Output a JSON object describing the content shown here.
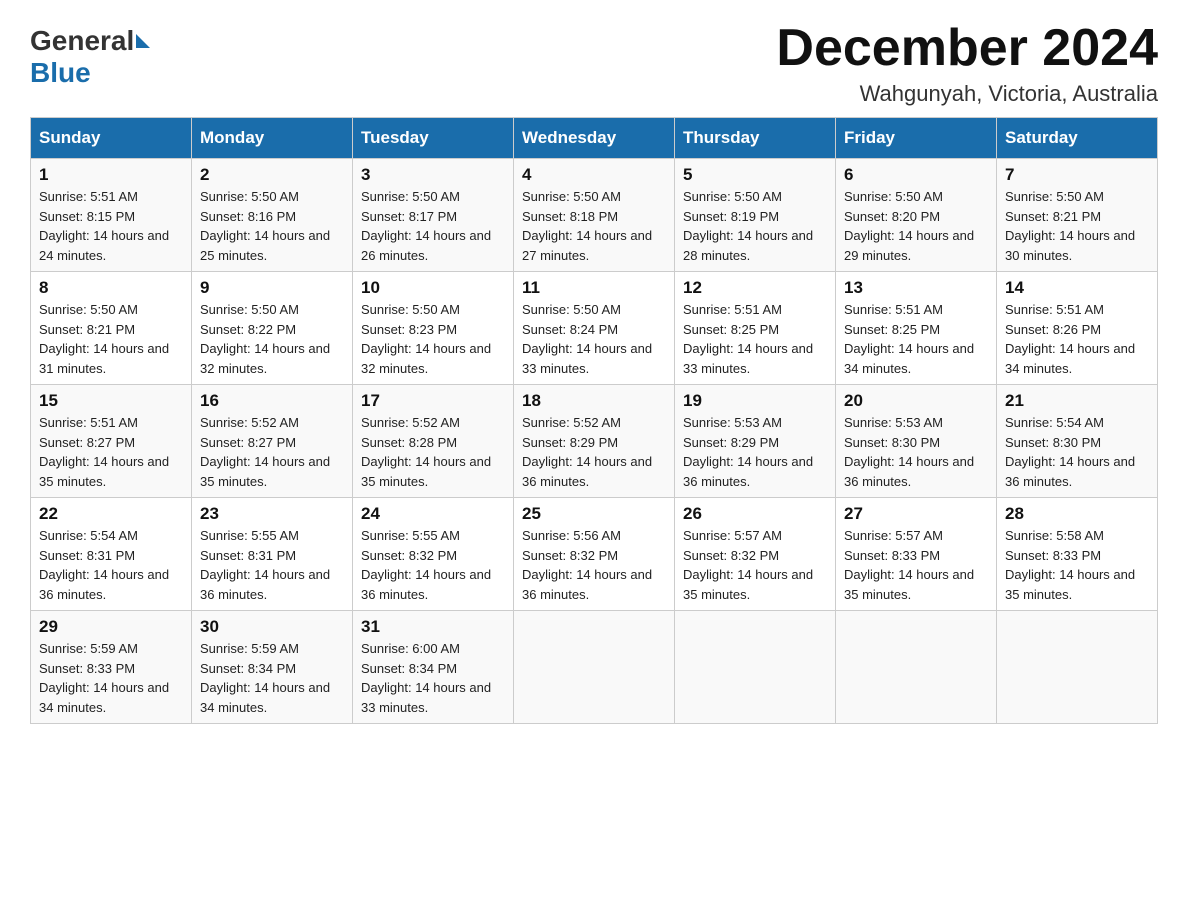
{
  "header": {
    "logo": {
      "general": "General",
      "blue": "Blue"
    },
    "title": "December 2024",
    "location": "Wahgunyah, Victoria, Australia"
  },
  "calendar": {
    "headers": [
      "Sunday",
      "Monday",
      "Tuesday",
      "Wednesday",
      "Thursday",
      "Friday",
      "Saturday"
    ],
    "rows": [
      [
        {
          "day": "1",
          "sunrise": "5:51 AM",
          "sunset": "8:15 PM",
          "daylight": "14 hours and 24 minutes."
        },
        {
          "day": "2",
          "sunrise": "5:50 AM",
          "sunset": "8:16 PM",
          "daylight": "14 hours and 25 minutes."
        },
        {
          "day": "3",
          "sunrise": "5:50 AM",
          "sunset": "8:17 PM",
          "daylight": "14 hours and 26 minutes."
        },
        {
          "day": "4",
          "sunrise": "5:50 AM",
          "sunset": "8:18 PM",
          "daylight": "14 hours and 27 minutes."
        },
        {
          "day": "5",
          "sunrise": "5:50 AM",
          "sunset": "8:19 PM",
          "daylight": "14 hours and 28 minutes."
        },
        {
          "day": "6",
          "sunrise": "5:50 AM",
          "sunset": "8:20 PM",
          "daylight": "14 hours and 29 minutes."
        },
        {
          "day": "7",
          "sunrise": "5:50 AM",
          "sunset": "8:21 PM",
          "daylight": "14 hours and 30 minutes."
        }
      ],
      [
        {
          "day": "8",
          "sunrise": "5:50 AM",
          "sunset": "8:21 PM",
          "daylight": "14 hours and 31 minutes."
        },
        {
          "day": "9",
          "sunrise": "5:50 AM",
          "sunset": "8:22 PM",
          "daylight": "14 hours and 32 minutes."
        },
        {
          "day": "10",
          "sunrise": "5:50 AM",
          "sunset": "8:23 PM",
          "daylight": "14 hours and 32 minutes."
        },
        {
          "day": "11",
          "sunrise": "5:50 AM",
          "sunset": "8:24 PM",
          "daylight": "14 hours and 33 minutes."
        },
        {
          "day": "12",
          "sunrise": "5:51 AM",
          "sunset": "8:25 PM",
          "daylight": "14 hours and 33 minutes."
        },
        {
          "day": "13",
          "sunrise": "5:51 AM",
          "sunset": "8:25 PM",
          "daylight": "14 hours and 34 minutes."
        },
        {
          "day": "14",
          "sunrise": "5:51 AM",
          "sunset": "8:26 PM",
          "daylight": "14 hours and 34 minutes."
        }
      ],
      [
        {
          "day": "15",
          "sunrise": "5:51 AM",
          "sunset": "8:27 PM",
          "daylight": "14 hours and 35 minutes."
        },
        {
          "day": "16",
          "sunrise": "5:52 AM",
          "sunset": "8:27 PM",
          "daylight": "14 hours and 35 minutes."
        },
        {
          "day": "17",
          "sunrise": "5:52 AM",
          "sunset": "8:28 PM",
          "daylight": "14 hours and 35 minutes."
        },
        {
          "day": "18",
          "sunrise": "5:52 AM",
          "sunset": "8:29 PM",
          "daylight": "14 hours and 36 minutes."
        },
        {
          "day": "19",
          "sunrise": "5:53 AM",
          "sunset": "8:29 PM",
          "daylight": "14 hours and 36 minutes."
        },
        {
          "day": "20",
          "sunrise": "5:53 AM",
          "sunset": "8:30 PM",
          "daylight": "14 hours and 36 minutes."
        },
        {
          "day": "21",
          "sunrise": "5:54 AM",
          "sunset": "8:30 PM",
          "daylight": "14 hours and 36 minutes."
        }
      ],
      [
        {
          "day": "22",
          "sunrise": "5:54 AM",
          "sunset": "8:31 PM",
          "daylight": "14 hours and 36 minutes."
        },
        {
          "day": "23",
          "sunrise": "5:55 AM",
          "sunset": "8:31 PM",
          "daylight": "14 hours and 36 minutes."
        },
        {
          "day": "24",
          "sunrise": "5:55 AM",
          "sunset": "8:32 PM",
          "daylight": "14 hours and 36 minutes."
        },
        {
          "day": "25",
          "sunrise": "5:56 AM",
          "sunset": "8:32 PM",
          "daylight": "14 hours and 36 minutes."
        },
        {
          "day": "26",
          "sunrise": "5:57 AM",
          "sunset": "8:32 PM",
          "daylight": "14 hours and 35 minutes."
        },
        {
          "day": "27",
          "sunrise": "5:57 AM",
          "sunset": "8:33 PM",
          "daylight": "14 hours and 35 minutes."
        },
        {
          "day": "28",
          "sunrise": "5:58 AM",
          "sunset": "8:33 PM",
          "daylight": "14 hours and 35 minutes."
        }
      ],
      [
        {
          "day": "29",
          "sunrise": "5:59 AM",
          "sunset": "8:33 PM",
          "daylight": "14 hours and 34 minutes."
        },
        {
          "day": "30",
          "sunrise": "5:59 AM",
          "sunset": "8:34 PM",
          "daylight": "14 hours and 34 minutes."
        },
        {
          "day": "31",
          "sunrise": "6:00 AM",
          "sunset": "8:34 PM",
          "daylight": "14 hours and 33 minutes."
        },
        null,
        null,
        null,
        null
      ]
    ]
  }
}
